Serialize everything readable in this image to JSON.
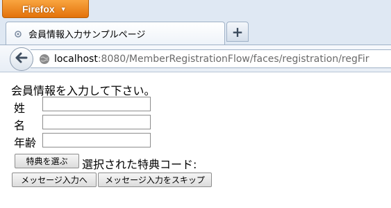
{
  "browser": {
    "menu_button_label": "Firefox",
    "tab": {
      "title": "会員情報入力サンプルページ"
    },
    "new_tab_label": "+",
    "url": {
      "host": "localhost",
      "rest": ":8080/MemberRegistrationFlow/faces/registration/regFir"
    }
  },
  "page": {
    "instructions": "会員情報を入力して下さい。",
    "fields": [
      {
        "label": "姓",
        "value": ""
      },
      {
        "label": "名",
        "value": ""
      },
      {
        "label": "年齢",
        "value": ""
      }
    ],
    "benefit_button_label": "特典を選ぶ",
    "selected_benefit_text": "選択された特典コード:",
    "message_button_label": "メッセージ入力へ",
    "skip_button_label": "メッセージ入力をスキップ"
  },
  "colors": {
    "firefox_orange": "#e3720b",
    "chrome_bg": "#dfe8f3"
  }
}
